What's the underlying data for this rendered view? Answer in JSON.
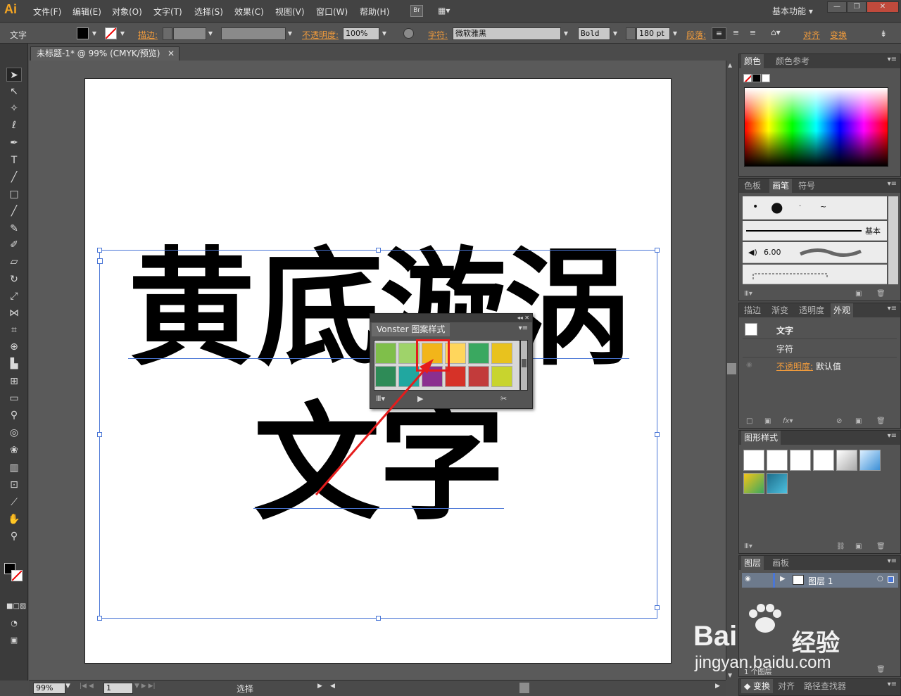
{
  "app": {
    "logo": "Ai",
    "workspace": "基本功能",
    "bridge": "Br"
  },
  "menu": [
    "文件(F)",
    "编辑(E)",
    "对象(O)",
    "文字(T)",
    "选择(S)",
    "效果(C)",
    "视图(V)",
    "窗口(W)",
    "帮助(H)"
  ],
  "control": {
    "tool_label": "文字",
    "stroke_label": "描边:",
    "opacity_label": "不透明度:",
    "opacity_value": "100%",
    "char_label": "字符:",
    "font_family": "微软雅黑",
    "font_style": "Bold",
    "font_size": "180 pt",
    "paragraph_label": "段落:",
    "align_label": "对齐",
    "transform_label": "变换"
  },
  "document": {
    "tab_title": "未标题-1* @ 99% (CMYK/预览)",
    "line1": [
      "黄",
      "底",
      "漩",
      "涡"
    ],
    "line2": [
      "文",
      "字"
    ]
  },
  "vonster_panel": {
    "title": "Vonster 图案样式",
    "swatch_colors": [
      "#7fbf4a",
      "#9fd36a",
      "#f2b51a",
      "#ffd65c",
      "#3aa860",
      "#e8c21e",
      "#2e8b57",
      "#21a7a0",
      "#8b2f8f",
      "#d63228",
      "#c23b3b",
      "#c8d42e"
    ]
  },
  "panels": {
    "color": {
      "tabs": [
        "颜色",
        "颜色参考"
      ]
    },
    "brushes": {
      "tabs": [
        "色板",
        "画笔",
        "符号"
      ],
      "basic_label": "基本",
      "size_value": "6.00"
    },
    "appearance": {
      "tabs": [
        "描边",
        "渐变",
        "透明度",
        "外观"
      ],
      "object": "文字",
      "char_row": "字符",
      "opacity_label": "不透明度:",
      "opacity_value": "默认值"
    },
    "graphic_styles": {
      "title": "图形样式"
    },
    "layers": {
      "tabs": [
        "图层",
        "画板"
      ],
      "layer_name": "图层 1",
      "count_label": "1 个图层"
    },
    "bottom_tabs": [
      "变换",
      "对齐",
      "路径查找器"
    ]
  },
  "status": {
    "zoom": "99%",
    "page": "1",
    "mode": "选择"
  },
  "watermark": {
    "brand": "Bai",
    "brand2": "经验",
    "url": "jingyan.baidu.com"
  }
}
